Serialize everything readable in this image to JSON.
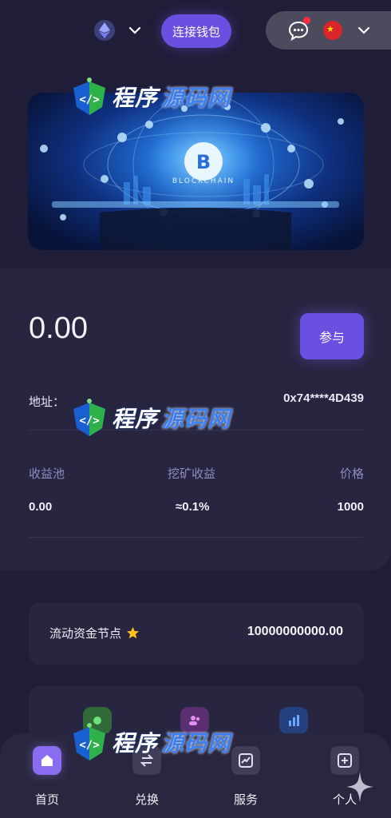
{
  "header": {
    "network_icon": "ethereum-icon",
    "connect_label": "连接钱包",
    "message_icon": "chat-icon",
    "flag_icon": "china-flag-icon"
  },
  "banner": {
    "image": "blockchain-bitcoin-banner",
    "caption": "BLOCKCHAIN"
  },
  "account": {
    "balance": "0.00",
    "join_label": "参与",
    "address_label": "地址：",
    "address_value": "0x74****4D439"
  },
  "stats": [
    {
      "label": "收益池",
      "value": "0.00"
    },
    {
      "label": "挖矿收益",
      "value": "≈0.1%"
    },
    {
      "label": "价格",
      "value": "1000"
    }
  ],
  "node": {
    "label": "流动资金节点",
    "value": "10000000000.00",
    "icon": "star-icon"
  },
  "nav": [
    {
      "label": "首页",
      "icon": "home-icon",
      "active": true
    },
    {
      "label": "兑换",
      "icon": "swap-icon",
      "active": false
    },
    {
      "label": "服务",
      "icon": "chart-icon",
      "active": false
    },
    {
      "label": "个人",
      "icon": "plus-square-icon",
      "active": false
    }
  ],
  "watermark": {
    "part1": "程序",
    "part2": "源码网"
  },
  "colors": {
    "background": "#1f1d38",
    "card": "#27253f",
    "accent": "#6a4fe0",
    "muted_label": "#8f8cc0"
  }
}
